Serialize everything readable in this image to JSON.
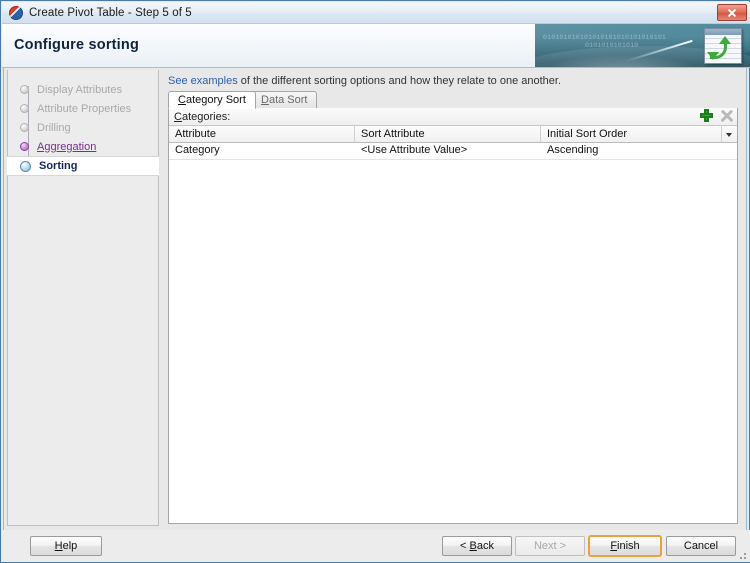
{
  "window": {
    "title": "Create Pivot Table - Step 5 of 5",
    "app_icon": "oracle-logo-icon",
    "close_label": "✕"
  },
  "header": {
    "title": "Configure sorting",
    "banner_icon": "pivot-table-icon",
    "banner_binary_line1": "010101010101010101010101010101",
    "banner_binary_line2": "0101010101010"
  },
  "sidebar": {
    "items": [
      {
        "label": "Display Attributes",
        "state": "disabled"
      },
      {
        "label": "Attribute Properties",
        "state": "disabled"
      },
      {
        "label": "Drilling",
        "state": "disabled"
      },
      {
        "label": "Aggregation",
        "state": "done"
      },
      {
        "label": "Sorting",
        "state": "current"
      }
    ]
  },
  "main": {
    "intro_link": "See examples",
    "intro_rest": " of the different sorting options and how they relate to one another.",
    "tabs": [
      {
        "label": "Category Sort",
        "active": true
      },
      {
        "label": "Data Sort",
        "active": false
      }
    ],
    "panel": {
      "label": "Categories:",
      "add_icon": "plus-icon",
      "delete_icon": "delete-x-icon",
      "menu_icon": "chevron-down-icon",
      "columns": [
        "Attribute",
        "Sort Attribute",
        "Initial Sort Order"
      ],
      "rows": [
        [
          "Category",
          "<Use Attribute Value>",
          "Ascending"
        ]
      ]
    }
  },
  "footer": {
    "help": "Help",
    "back": "< Back",
    "next": "Next >",
    "finish": "Finish",
    "cancel": "Cancel"
  },
  "colors": {
    "accent_link": "#2d5fa8",
    "visited_step": "#7a2d8f",
    "current_step": "#11275c",
    "focus_border": "#e8a33d",
    "add_green": "#2eaa2e",
    "banner_teal": "#3f7f93"
  }
}
